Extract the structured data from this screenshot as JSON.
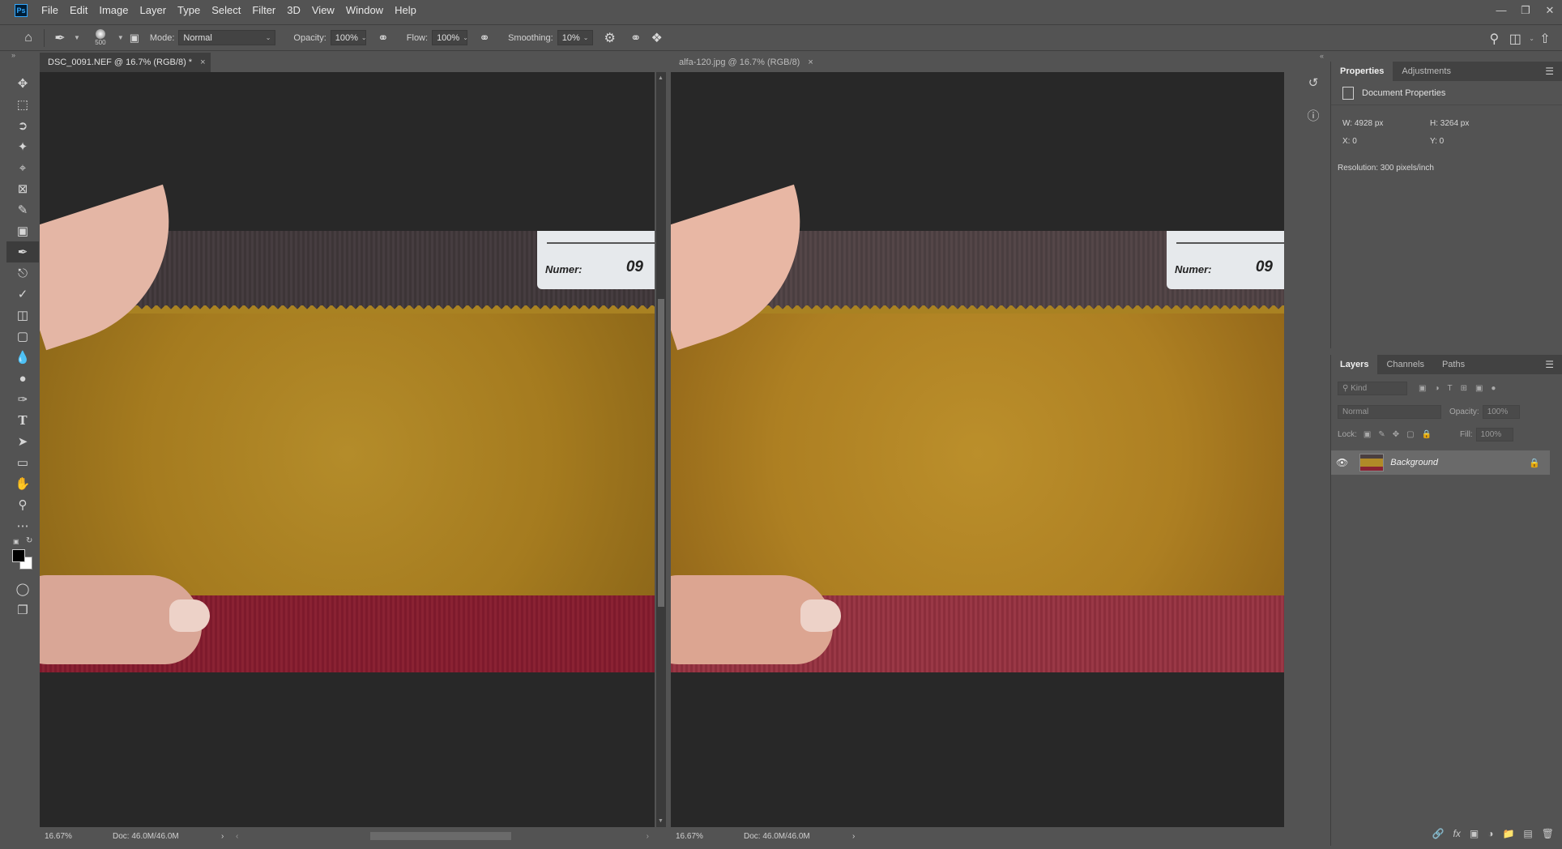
{
  "app": {
    "logo": "Ps"
  },
  "menu": [
    "File",
    "Edit",
    "Image",
    "Layer",
    "Type",
    "Select",
    "Filter",
    "3D",
    "View",
    "Window",
    "Help"
  ],
  "options": {
    "brush_size": "500",
    "mode_label": "Mode:",
    "mode_value": "Normal",
    "opacity_label": "Opacity:",
    "opacity_value": "100%",
    "flow_label": "Flow:",
    "flow_value": "100%",
    "smoothing_label": "Smoothing:",
    "smoothing_value": "10%"
  },
  "docs": [
    {
      "tab": "DSC_0091.NEF @ 16.7% (RGB/8) *",
      "zoom": "16.67%",
      "doc_size": "Doc: 46.0M/46.0M",
      "label_key": "Numer:",
      "label_value": "09"
    },
    {
      "tab": "alfa-120.jpg @ 16.7% (RGB/8)",
      "zoom": "16.67%",
      "doc_size": "Doc: 46.0M/46.0M",
      "label_key": "Numer:",
      "label_value": "09"
    }
  ],
  "properties": {
    "tabs": [
      "Properties",
      "Adjustments"
    ],
    "section": "Document Properties",
    "w": "W:  4928 px",
    "h": "H:  3264 px",
    "x": "X:  0",
    "y": "Y:  0",
    "resolution": "Resolution: 300 pixels/inch"
  },
  "layers": {
    "tabs": [
      "Layers",
      "Channels",
      "Paths"
    ],
    "filter_placeholder": "Kind",
    "blend_mode": "Normal",
    "opacity_label": "Opacity:",
    "opacity_value": "100%",
    "lock_label": "Lock:",
    "fill_label": "Fill:",
    "fill_value": "100%",
    "items": [
      {
        "name": "Background",
        "visible": true,
        "locked": true
      }
    ]
  },
  "colors": {
    "accent": "#31a8ff",
    "panel": "#535353",
    "canvas": "#282828"
  }
}
